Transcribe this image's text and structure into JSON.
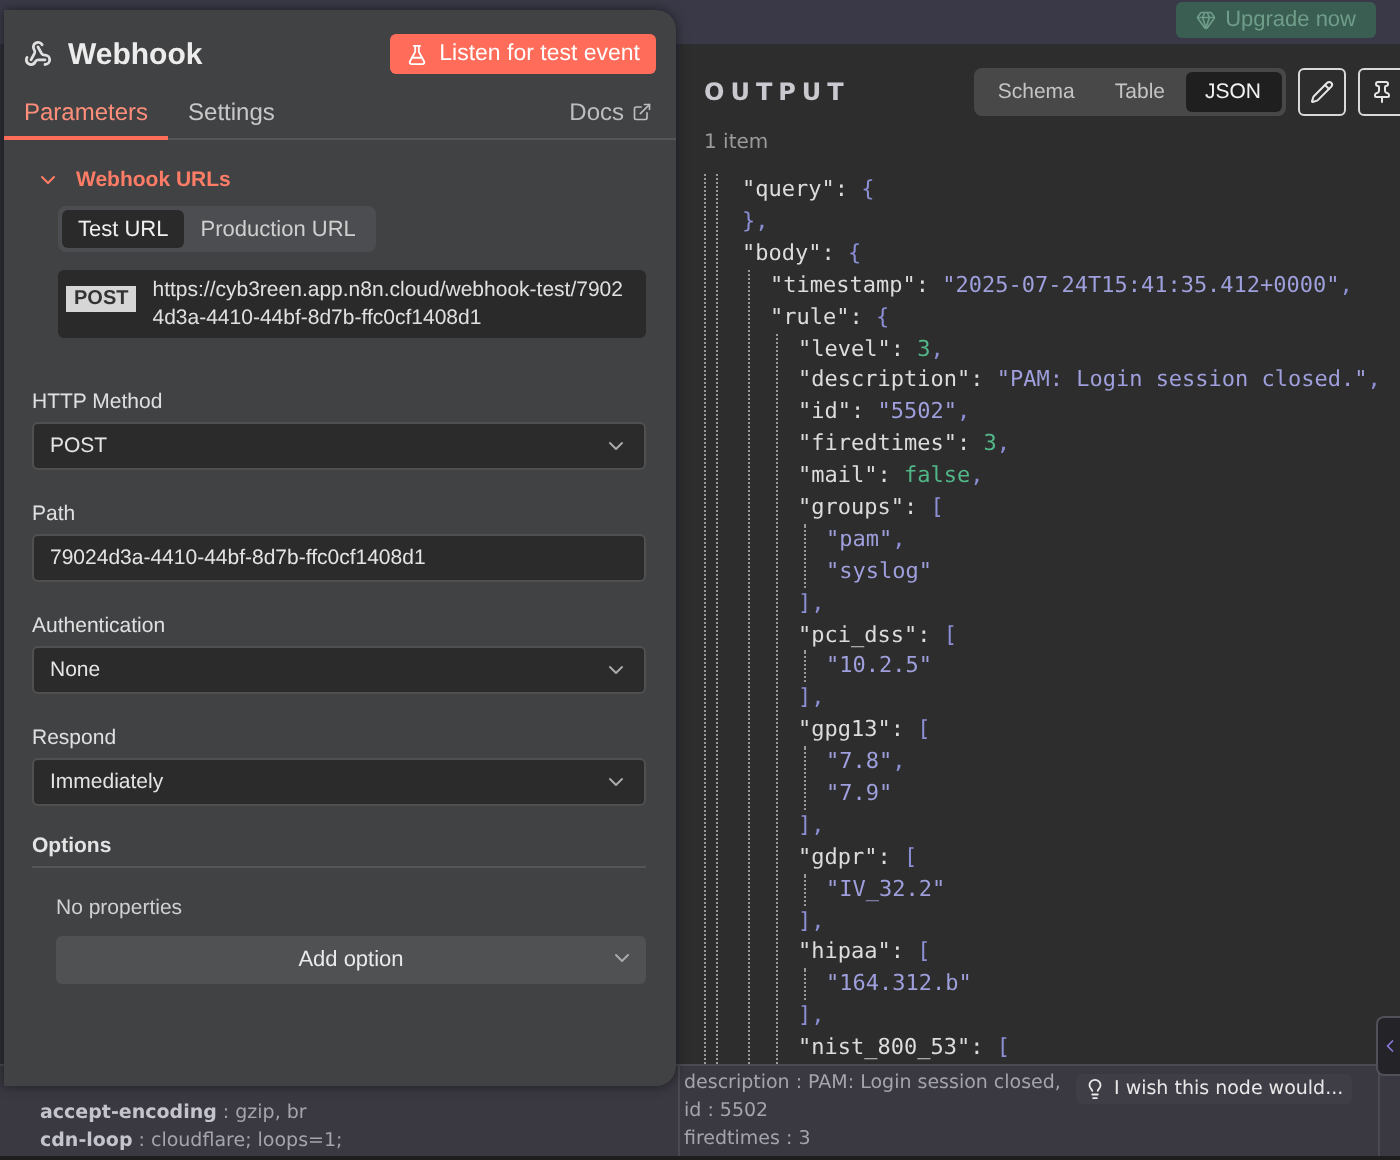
{
  "top_bar": {
    "upgrade_button": "Upgrade now"
  },
  "node_panel": {
    "title": "Webhook",
    "listen_button": "Listen for test event",
    "tabs": [
      {
        "label": "Parameters",
        "selected": true
      },
      {
        "label": "Settings",
        "selected": false
      }
    ],
    "docs_link": "Docs",
    "webhook_urls": {
      "title": "Webhook URLs",
      "expanded": true,
      "url_tabs": [
        {
          "label": "Test URL",
          "selected": true
        },
        {
          "label": "Production URL",
          "selected": false
        }
      ],
      "method": "POST",
      "url": "https://cyb3reen.app.n8n.cloud/webhook-test/79024d3a-4410-44bf-8d7b-ffc0cf1408d1"
    },
    "fields": [
      {
        "label": "HTTP Method",
        "kind": "select",
        "value": "POST"
      },
      {
        "label": "Path",
        "kind": "input",
        "value": "79024d3a-4410-44bf-8d7b-ffc0cf1408d1"
      },
      {
        "label": "Authentication",
        "kind": "select",
        "value": "None"
      },
      {
        "label": "Respond",
        "kind": "select",
        "value": "Immediately"
      }
    ],
    "options": {
      "title": "Options",
      "empty_text": "No properties",
      "add_button": "Add option"
    }
  },
  "output": {
    "title": "OUTPUT",
    "views": [
      {
        "label": "Schema",
        "selected": false
      },
      {
        "label": "Table",
        "selected": false
      },
      {
        "label": "JSON",
        "selected": true
      }
    ],
    "count": "1 item",
    "json": [
      {
        "key": "\"query\":",
        "open": "{",
        "close": "},"
      },
      {
        "key": "\"body\":",
        "open": "{",
        "children": [
          {
            "key": "\"timestamp\":",
            "value": "\"2025-07-24T15:41:35.412+0000\"",
            "kind": "string",
            "trail": ","
          },
          {
            "key": "\"rule\":",
            "open": "{",
            "children": [
              {
                "key": "\"level\":",
                "value": "3",
                "kind": "number",
                "trail": ","
              },
              {
                "key": "\"description\":",
                "value": "\"PAM: Login session closed.\"",
                "kind": "string",
                "trail": ","
              },
              {
                "key": "\"id\":",
                "value": "\"5502\"",
                "kind": "string",
                "trail": ","
              },
              {
                "key": "\"firedtimes\":",
                "value": "3",
                "kind": "number",
                "trail": ","
              },
              {
                "key": "\"mail\":",
                "value": "false",
                "kind": "boolean",
                "trail": ","
              },
              {
                "key": "\"groups\":",
                "open": "[",
                "children": [
                  {
                    "value": "\"pam\"",
                    "kind": "string",
                    "trail": ","
                  },
                  {
                    "value": "\"syslog\"",
                    "kind": "string"
                  }
                ],
                "close": "],"
              },
              {
                "key": "\"pci_dss\":",
                "open": "[",
                "children": [
                  {
                    "value": "\"10.2.5\"",
                    "kind": "string"
                  }
                ],
                "close": "],"
              },
              {
                "key": "\"gpg13\":",
                "open": "[",
                "children": [
                  {
                    "value": "\"7.8\"",
                    "kind": "string",
                    "trail": ","
                  },
                  {
                    "value": "\"7.9\"",
                    "kind": "string"
                  }
                ],
                "close": "],"
              },
              {
                "key": "\"gdpr\":",
                "open": "[",
                "children": [
                  {
                    "value": "\"IV_32.2\"",
                    "kind": "string"
                  }
                ],
                "close": "],"
              },
              {
                "key": "\"hipaa\":",
                "open": "[",
                "children": [
                  {
                    "value": "\"164.312.b\"",
                    "kind": "string"
                  }
                ],
                "close": "],"
              },
              {
                "key": "\"nist_800_53\":",
                "open": "["
              }
            ]
          }
        ]
      }
    ]
  },
  "canvas_strip": {
    "left": [
      "**accept-encoding** : gzip, br",
      "**cdn-loop** : cloudflare; loops=1;"
    ],
    "right": [
      "description : PAM: Login session closed,",
      "id : 5502",
      "firedtimes : 3"
    ],
    "feedback": "I wish this node would..."
  }
}
